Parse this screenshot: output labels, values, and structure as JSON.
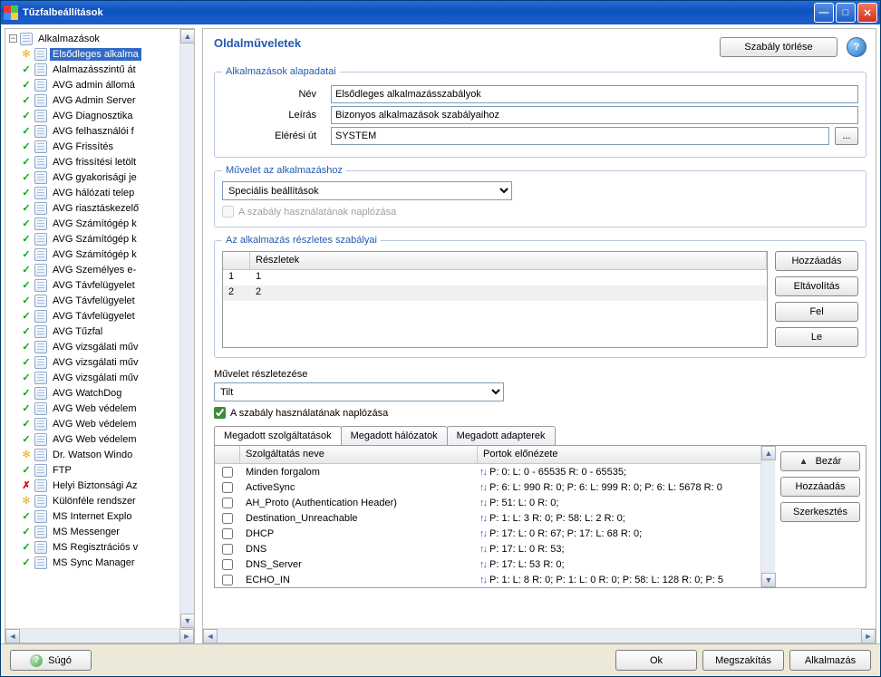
{
  "window": {
    "title": "Tűzfalbeállítások"
  },
  "tree": {
    "root": "Alkalmazások",
    "items": [
      {
        "status": "gear",
        "label": "Elsődleges alkalma",
        "selected": true
      },
      {
        "status": "green",
        "label": "Alalmazásszintű át"
      },
      {
        "status": "green",
        "label": "AVG admin állomá"
      },
      {
        "status": "green",
        "label": "AVG Admin Server"
      },
      {
        "status": "green",
        "label": "AVG Diagnosztika"
      },
      {
        "status": "green",
        "label": "AVG felhasználói f"
      },
      {
        "status": "green",
        "label": "AVG Frissítés"
      },
      {
        "status": "green",
        "label": "AVG frissítési letölt"
      },
      {
        "status": "green",
        "label": "AVG gyakorisági je"
      },
      {
        "status": "green",
        "label": "AVG hálózati telep"
      },
      {
        "status": "green",
        "label": "AVG riasztáskezelő"
      },
      {
        "status": "green",
        "label": "AVG Számítógép k"
      },
      {
        "status": "green",
        "label": "AVG Számítógép k"
      },
      {
        "status": "green",
        "label": "AVG Számítógép k"
      },
      {
        "status": "green",
        "label": "AVG Személyes e-"
      },
      {
        "status": "green",
        "label": "AVG Távfelügyelet"
      },
      {
        "status": "green",
        "label": "AVG Távfelügyelet"
      },
      {
        "status": "green",
        "label": "AVG Távfelügyelet"
      },
      {
        "status": "green",
        "label": "AVG Tűzfal"
      },
      {
        "status": "green",
        "label": "AVG vizsgálati műv"
      },
      {
        "status": "green",
        "label": "AVG vizsgálati műv"
      },
      {
        "status": "green",
        "label": "AVG vizsgálati műv"
      },
      {
        "status": "green",
        "label": "AVG WatchDog"
      },
      {
        "status": "green",
        "label": "AVG Web védelem"
      },
      {
        "status": "green",
        "label": "AVG Web védelem"
      },
      {
        "status": "green",
        "label": "AVG Web védelem"
      },
      {
        "status": "gear",
        "label": "Dr. Watson Windo"
      },
      {
        "status": "green",
        "label": "FTP"
      },
      {
        "status": "redx",
        "label": "Helyi Biztonsági Az"
      },
      {
        "status": "gear",
        "label": "Különféle rendszer"
      },
      {
        "status": "green",
        "label": "MS Internet Explo"
      },
      {
        "status": "green",
        "label": "MS Messenger"
      },
      {
        "status": "green",
        "label": "MS Regisztrációs v"
      },
      {
        "status": "green",
        "label": "MS Sync Manager"
      }
    ]
  },
  "page": {
    "title": "Oldalműveletek",
    "delete_rule": "Szabály törlése"
  },
  "app_basics": {
    "legend": "Alkalmazások alapadatai",
    "name_label": "Név",
    "name_value": "Elsődleges alkalmazásszabályok",
    "desc_label": "Leírás",
    "desc_value": "Bizonyos alkalmazások szabályaihoz",
    "path_label": "Elérési út",
    "path_value": "SYSTEM",
    "browse": "..."
  },
  "app_action": {
    "legend": "Művelet az alkalmazáshoz",
    "combo": "Speciális beállítások",
    "log_label": "A szabály használatának naplózása"
  },
  "detail_rules": {
    "legend": "Az alkalmazás részletes szabályai",
    "col_details": "Részletek",
    "rows": [
      {
        "n": "1",
        "d": "1"
      },
      {
        "n": "2",
        "d": "2"
      }
    ],
    "btn_add": "Hozzáadás",
    "btn_remove": "Eltávolítás",
    "btn_up": "Fel",
    "btn_down": "Le"
  },
  "op_detail": {
    "label": "Művelet részletezése",
    "combo": "Tilt",
    "log_label": "A szabály használatának naplózása"
  },
  "tabs": {
    "t1": "Megadott szolgáltatások",
    "t2": "Megadott hálózatok",
    "t3": "Megadott adapterek",
    "col_name": "Szolgáltatás neve",
    "col_ports": "Portok előnézete",
    "rows": [
      {
        "name": "Minden forgalom",
        "ports": "P: 0:  L: 0 - 65535 R: 0 - 65535;"
      },
      {
        "name": "ActiveSync",
        "ports": "P: 6:  L: 990 R: 0; P: 6:  L: 999 R: 0; P: 6:  L: 5678 R: 0"
      },
      {
        "name": "AH_Proto (Authentication Header)",
        "ports": "P: 51:  L: 0 R: 0;"
      },
      {
        "name": "Destination_Unreachable",
        "ports": "P: 1:  L: 3 R: 0; P: 58:  L: 2 R: 0;"
      },
      {
        "name": "DHCP",
        "ports": "P: 17:  L: 0 R: 67; P: 17:  L: 68 R: 0;"
      },
      {
        "name": "DNS",
        "ports": "P: 17:  L: 0 R: 53;"
      },
      {
        "name": "DNS_Server",
        "ports": "P: 17:  L: 53 R: 0;"
      },
      {
        "name": "ECHO_IN",
        "ports": "P: 1:  L: 8 R: 0; P: 1:  L: 0 R: 0; P: 58:  L: 128 R: 0; P: 5"
      }
    ],
    "btn_close": "Bezár",
    "btn_add": "Hozzáadás",
    "btn_edit": "Szerkesztés"
  },
  "bottom": {
    "help": "Súgó",
    "ok": "Ok",
    "cancel": "Megszakítás",
    "apply": "Alkalmazás"
  }
}
